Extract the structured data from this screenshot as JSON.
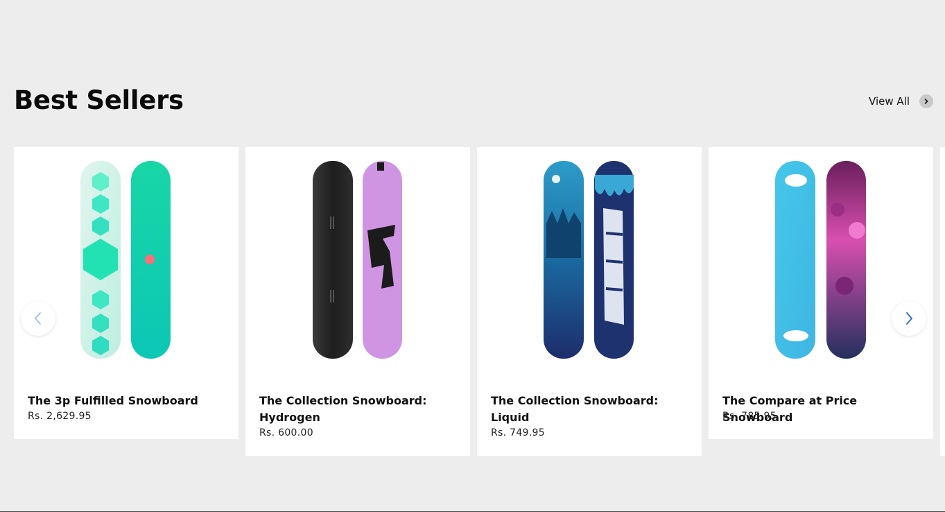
{
  "section": {
    "title": "Best Sellers",
    "view_all_label": "View All"
  },
  "icons": {
    "view_all": "chevron-right-icon",
    "prev": "chevron-left-icon",
    "next": "chevron-right-icon"
  },
  "colors": {
    "page_background": "#ededed",
    "card_background": "#ffffff",
    "carousel_arrow": "#2f6fc5"
  },
  "products": [
    {
      "title": "The 3p Fulfilled Snowboard",
      "price": "Rs. 2,629.95"
    },
    {
      "title": "The Collection Snowboard: Hydrogen",
      "price": "Rs. 600.00"
    },
    {
      "title": "The Collection Snowboard: Liquid",
      "price": "Rs. 749.95"
    },
    {
      "title": "The Compare at Price Snowboard",
      "price": "Rs. 785.95"
    }
  ]
}
